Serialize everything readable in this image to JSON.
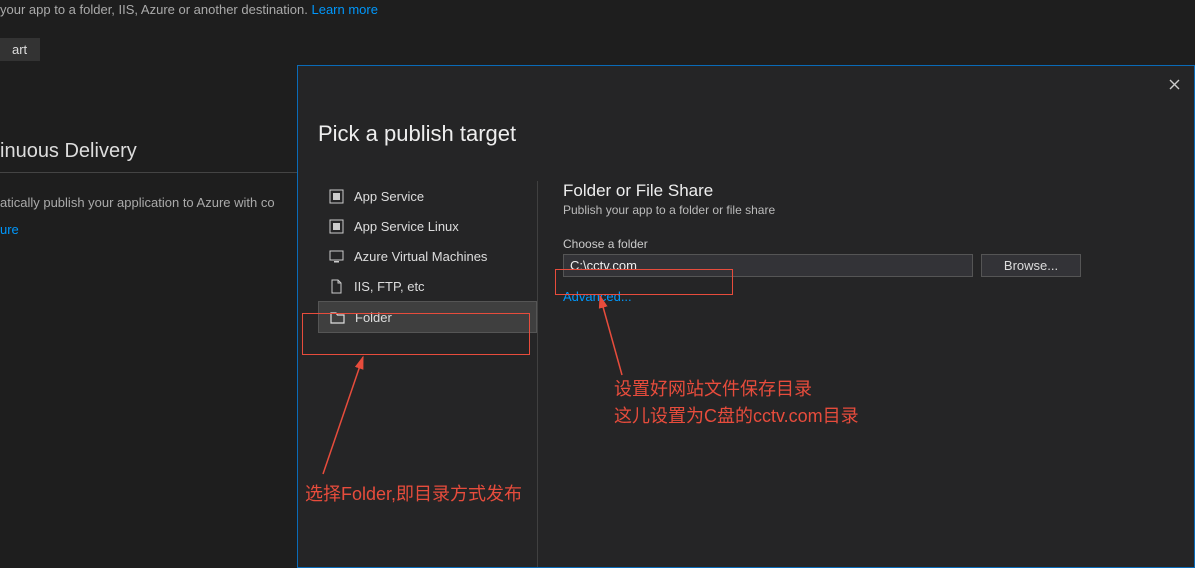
{
  "background": {
    "topText": " your app to a folder, IIS, Azure or another destination. ",
    "topLink": "Learn more",
    "startBtn": "art",
    "heading": "inuous Delivery",
    "line2": "atically publish your application to Azure with co",
    "link2": "ure"
  },
  "dialog": {
    "title": "Pick a publish target",
    "targets": [
      "App Service",
      "App Service Linux",
      "Azure Virtual Machines",
      "IIS, FTP, etc",
      "Folder"
    ],
    "detailTitle": "Folder or File Share",
    "detailSub": "Publish your app to a folder or file share",
    "fieldLabel": "Choose a folder",
    "folderValue": "C:\\cctv.com",
    "browse": "Browse...",
    "advanced": "Advanced..."
  },
  "annotations": {
    "left": "选择Folder,即目录方式发布",
    "right1": "设置好网站文件保存目录",
    "right2": "这儿设置为C盘的cctv.com目录"
  }
}
